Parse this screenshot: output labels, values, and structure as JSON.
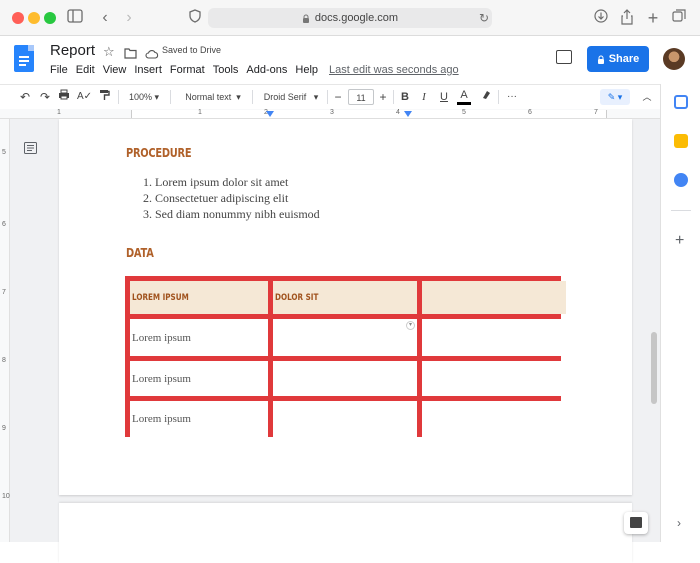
{
  "browser": {
    "url": "docs.google.com"
  },
  "header": {
    "title": "Report",
    "saved_status": "Saved to Drive",
    "menus": [
      "File",
      "Edit",
      "View",
      "Insert",
      "Format",
      "Tools",
      "Add-ons",
      "Help"
    ],
    "last_edit": "Last edit was seconds ago",
    "share_label": "Share"
  },
  "toolbar": {
    "zoom": "100%",
    "style": "Normal text",
    "font": "Droid Serif",
    "font_size": "11",
    "minus": "−",
    "plus": "+",
    "bold": "B",
    "italic": "I",
    "underline": "U",
    "text_color": "A",
    "more": "···"
  },
  "ruler": {
    "h_numbers": [
      "1",
      "1",
      "2",
      "3",
      "4",
      "5",
      "6",
      "7"
    ],
    "v_numbers": [
      "5",
      "6",
      "7",
      "8",
      "9",
      "10"
    ]
  },
  "document": {
    "procedure_heading": "PROCEDURE",
    "procedure_items": [
      "1.   Lorem ipsum dolor sit amet",
      "2.   Consectetuer adipiscing elit",
      "3.   Sed diam nonummy nibh euismod"
    ],
    "data_heading": "DATA",
    "table": {
      "headers": [
        "LOREM IPSUM",
        "DOLOR SIT",
        ""
      ],
      "rows": [
        [
          "Lorem ipsum",
          "",
          ""
        ],
        [
          "Lorem ipsum",
          "",
          ""
        ],
        [
          "Lorem ipsum",
          "",
          ""
        ]
      ],
      "border_color": "#e0393b",
      "header_bg": "#f5e8d6"
    }
  },
  "colors": {
    "accent": "#1a73e8",
    "heading": "#b0612a"
  }
}
